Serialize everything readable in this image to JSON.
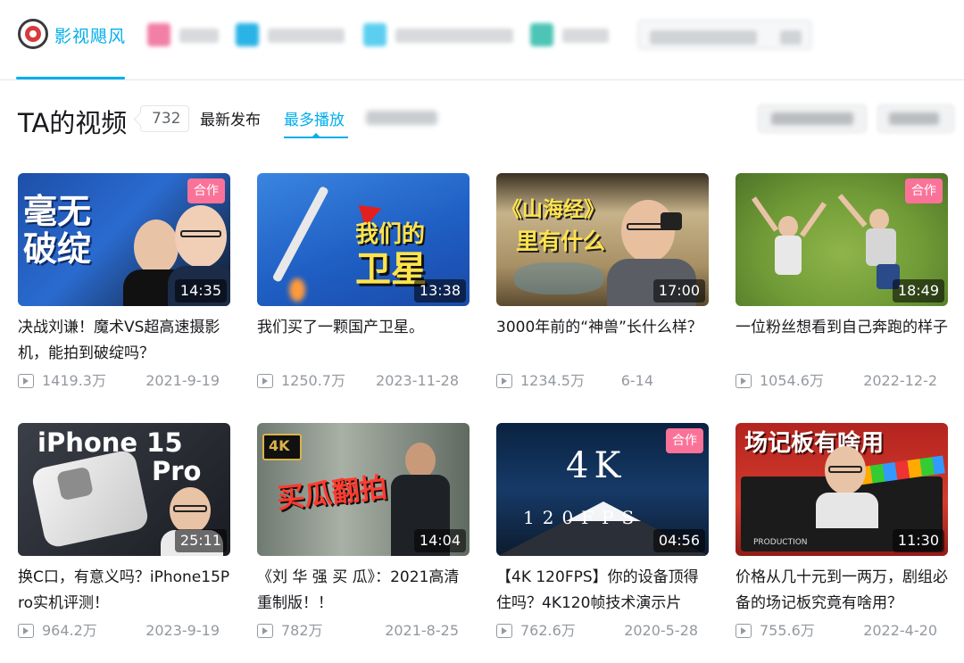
{
  "nav": {
    "channel_name": "影视飓风",
    "tabs": [
      {
        "icon": "pink-square-icon",
        "color": "#f27fa6"
      },
      {
        "icon": "blue-square-icon",
        "color": "#2ab3e6"
      },
      {
        "icon": "light-blue-square-icon",
        "color": "#5ccff0"
      },
      {
        "icon": "teal-square-icon",
        "color": "#4dc4b5"
      }
    ]
  },
  "section": {
    "title": "TA的视频",
    "count": "732",
    "sort_latest": "最新发布",
    "sort_most_played": "最多播放"
  },
  "videos": [
    {
      "title": "决战刘谦！魔术VS超高速摄影机，能拍到破绽吗？",
      "duration": "14:35",
      "plays": "1419.3万",
      "date": "2021-9-19",
      "collab": "合作",
      "thumb_text": [
        "毫无",
        "破绽"
      ]
    },
    {
      "title": "我们买了一颗国产卫星。",
      "duration": "13:38",
      "plays": "1250.7万",
      "date": "2023-11-28",
      "collab": "",
      "thumb_text": [
        "我们的",
        "卫星"
      ]
    },
    {
      "title": "3000年前的“神兽”长什么样？",
      "duration": "17:00",
      "plays": "1234.5万",
      "date": "6-14",
      "collab": "",
      "thumb_text": [
        "《山海经》",
        "里有什么"
      ]
    },
    {
      "title": "一位粉丝想看到自己奔跑的样子",
      "duration": "18:49",
      "plays": "1054.6万",
      "date": "2022-12-2",
      "collab": "合作",
      "thumb_text": []
    },
    {
      "title": "换C口，有意义吗？iPhone15Pro实机评测！",
      "duration": "25:11",
      "plays": "964.2万",
      "date": "2023-9-19",
      "collab": "",
      "thumb_text": [
        "iPhone 15",
        "Pro"
      ]
    },
    {
      "title": "《刘 华 强 买 瓜》：2021高清重制版！！",
      "duration": "14:04",
      "plays": "782万",
      "date": "2021-8-25",
      "collab": "",
      "thumb_text": [
        "买瓜翻拍",
        "4K"
      ]
    },
    {
      "title": "【4K 120FPS】你的设备顶得住吗？4K120帧技术演示片",
      "duration": "04:56",
      "plays": "762.6万",
      "date": "2020-5-28",
      "collab": "合作",
      "thumb_text": [
        "4K",
        "120FPS"
      ]
    },
    {
      "title": "价格从几十元到一两万，剧组必备的场记板究竟有啥用？",
      "duration": "11:30",
      "plays": "755.6万",
      "date": "2022-4-20",
      "collab": "",
      "thumb_text": [
        "场记板有啥用",
        "PRODUCTION"
      ]
    }
  ]
}
